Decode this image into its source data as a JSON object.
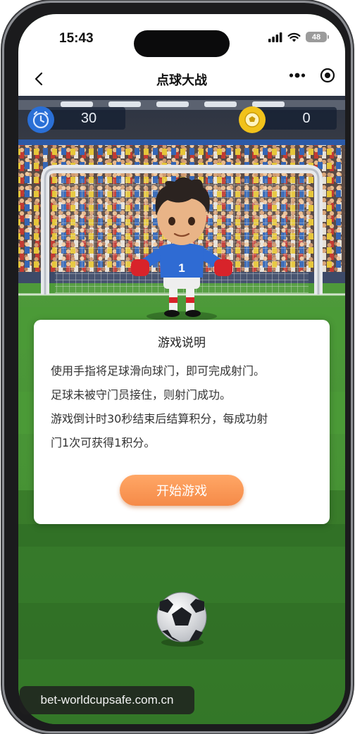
{
  "status_bar": {
    "time": "15:43",
    "battery": "48",
    "icons": [
      "cellular-signal-icon",
      "wifi-icon",
      "battery-icon"
    ]
  },
  "navbar": {
    "title": "点球大战",
    "back_icon": "chevron-left-icon",
    "more_icon": "more-dots-icon",
    "close_icon": "target-close-icon"
  },
  "hud": {
    "timer_icon": "alarm-clock-icon",
    "timer_value": "30",
    "score_icon": "soccer-ball-icon",
    "score_value": "0",
    "timer_color": "#2a6fd6",
    "score_color": "#f1c21b"
  },
  "modal": {
    "title": "游戏说明",
    "lines": [
      "使用手指将足球滑向球门，即可完成射门。",
      "足球未被守门员接住，则射门成功。",
      "游戏倒计时30秒结束后结算积分，每成功射",
      "门1次可获得1积分。"
    ],
    "start_button": "开始游戏",
    "button_color": "#f7914e"
  },
  "goalkeeper": {
    "jersey_number": "1",
    "jersey_color": "#2f6bd3",
    "glove_color": "#d8232a"
  },
  "watermark": "bet-worldcupsafe.com.cn"
}
